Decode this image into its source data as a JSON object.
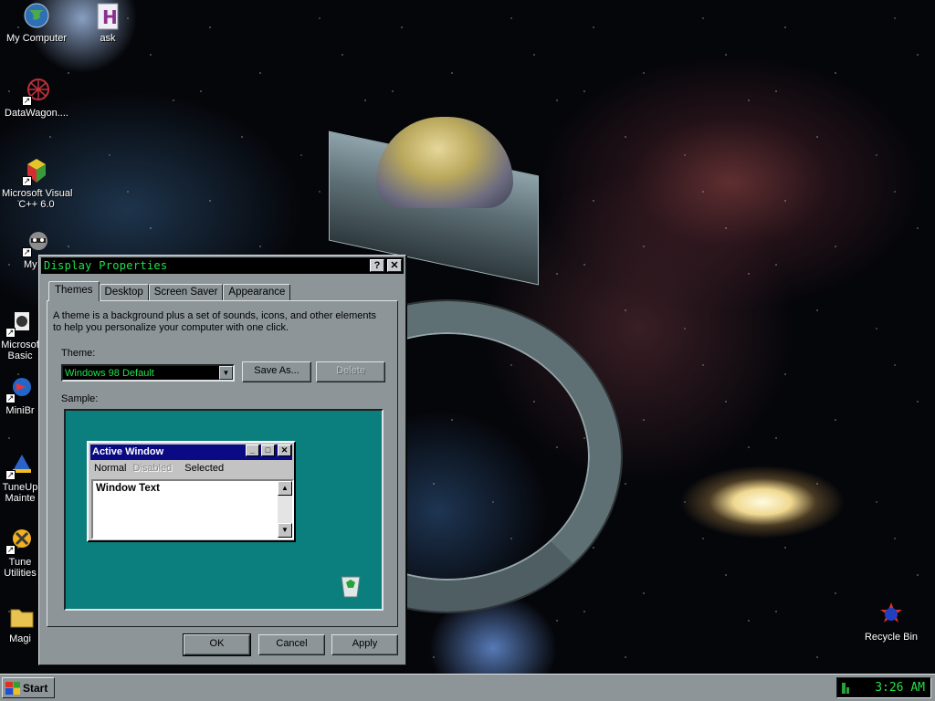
{
  "desktop": {
    "icons": [
      {
        "label": "My Computer",
        "icon": "globe-computer-icon"
      },
      {
        "label": "ask",
        "icon": "h-document-icon"
      },
      {
        "label": "DataWagon....",
        "icon": "red-web-icon"
      },
      {
        "label": "Microsoft Visual",
        "label2": "C++ 6.0",
        "icon": "visual-cpp-icon"
      },
      {
        "label": "My",
        "icon": "raccoon-icon"
      },
      {
        "label": "Microsof",
        "label2": "Basic",
        "icon": "ms-basic-icon"
      },
      {
        "label": "MiniBr",
        "icon": "minibrowser-icon"
      },
      {
        "label": "TuneUp",
        "label2": "Mainte",
        "icon": "tuneup-maintenance-icon"
      },
      {
        "label": "Tune",
        "label2": "Utilities",
        "icon": "tuneup-utilities-icon"
      },
      {
        "label": "Magi",
        "icon": "folder-icon"
      },
      {
        "label": "Recycle Bin",
        "icon": "recycle-bin-icon"
      }
    ]
  },
  "dialog": {
    "title": "Display Properties",
    "help_glyph": "?",
    "close_glyph": "✕",
    "tabs": [
      {
        "label": "Themes",
        "active": true
      },
      {
        "label": "Desktop",
        "active": false
      },
      {
        "label": "Screen Saver",
        "active": false
      },
      {
        "label": "Appearance",
        "active": false
      }
    ],
    "description": "A theme is a background plus a set of sounds, icons, and other elements to help you personalize your computer with one click.",
    "theme_label": "Theme:",
    "theme_value": "Windows 98 Default",
    "save_as_label": "Save As...",
    "delete_label": "Delete",
    "sample_label": "Sample:",
    "sample_window": {
      "title": "Active Window",
      "menu_normal": "Normal",
      "menu_disabled": "Disabled",
      "menu_selected": "Selected",
      "window_text": "Window Text"
    },
    "ok_label": "OK",
    "cancel_label": "Cancel",
    "apply_label": "Apply"
  },
  "taskbar": {
    "start_label": "Start",
    "clock": "3:26 AM"
  },
  "colors": {
    "dialog_face": "#8d9599",
    "title_text_green": "#22e04a",
    "sample_teal": "#0a7f7e",
    "sample_active_title": "#0a0a84"
  }
}
